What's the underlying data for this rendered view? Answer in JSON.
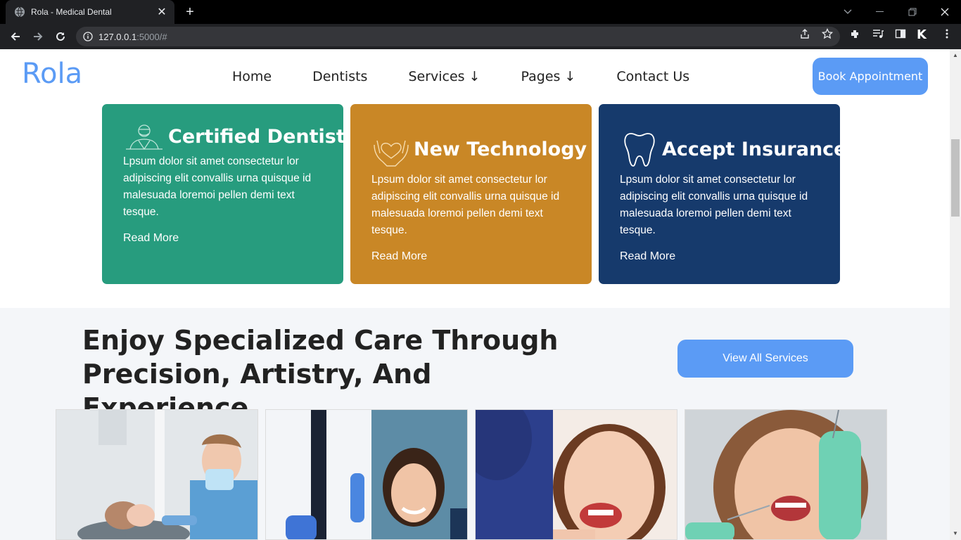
{
  "browser": {
    "tab_title": "Rola - Medical Dental",
    "url_host": "127.0.0.1",
    "url_rest": ":5000/#",
    "icons": [
      "globe-icon",
      "close-icon",
      "plus-icon",
      "chevron-down-icon",
      "minimize-icon",
      "restore-icon",
      "window-close-icon",
      "back-icon",
      "forward-icon",
      "reload-icon",
      "info-icon",
      "share-icon",
      "star-icon",
      "extensions-icon",
      "media-icon",
      "sidebar-icon",
      "profile-icon",
      "menu-icon"
    ],
    "profile_letter": "K"
  },
  "site": {
    "logo": "Rola",
    "nav": [
      "Home",
      "Dentists",
      "Services ↓",
      "Pages ↓",
      "Contact Us"
    ],
    "book_button": "Book Appointment"
  },
  "features": [
    {
      "title": "Certified Dentist",
      "text": "Lpsum dolor sit amet consectetur lor adipiscing elit convallis urna quisque id malesuada loremoi pellen demi text tesque.",
      "link": "Read More",
      "color": "#279c7e",
      "icon": "dentist-icon"
    },
    {
      "title": "New Technology",
      "text": "Lpsum dolor sit amet consectetur lor adipiscing elit convallis urna quisque id malesuada loremoi pellen demi text tesque.",
      "link": "Read More",
      "color": "#c98726",
      "icon": "heart-hands-icon"
    },
    {
      "title": "Accept Insurance",
      "text": "Lpsum dolor sit amet consectetur lor adipiscing elit convallis urna quisque id malesuada loremoi pellen demi text tesque.",
      "link": "Read More",
      "color": "#163a6c",
      "icon": "tooth-icon"
    }
  ],
  "services": {
    "heading_part1": "Enjoy Specialized ",
    "heading_bold1": "Care Through",
    "heading_bold2": "Precision,",
    "heading_part2": " Artistry, And Experience",
    "button": "View All Services"
  },
  "colors": {
    "accent": "#5b9bf5"
  }
}
